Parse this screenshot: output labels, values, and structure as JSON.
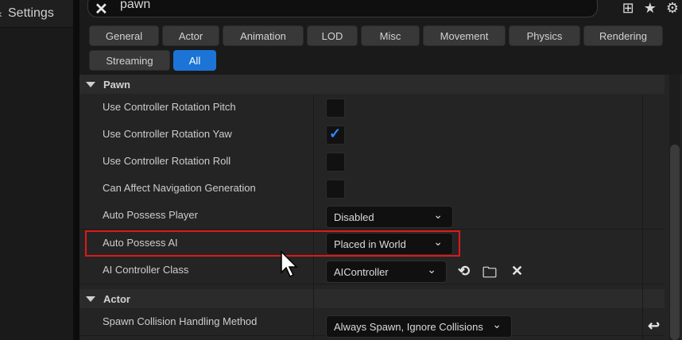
{
  "left": {
    "title": "Settings"
  },
  "search": {
    "value": "pawn"
  },
  "filters": [
    "General",
    "Actor",
    "Animation",
    "LOD",
    "Misc",
    "Movement",
    "Physics",
    "Rendering",
    "Streaming",
    "All"
  ],
  "categories": {
    "pawn": "Pawn",
    "actor": "Actor"
  },
  "rows": {
    "pitch": "Use Controller Rotation Pitch",
    "yaw": "Use Controller Rotation Yaw",
    "roll": "Use Controller Rotation Roll",
    "nav": "Can Affect Navigation Generation",
    "player": "Auto Possess Player",
    "ai": "Auto Possess AI",
    "aiclass": "AI Controller Class",
    "spawn": "Spawn Collision Handling Method"
  },
  "values": {
    "pitch": false,
    "yaw": true,
    "roll": false,
    "nav": false,
    "player": "Disabled",
    "ai": "Placed in World",
    "aiclass": "AIController",
    "spawn": "Always Spawn, Ignore Collisions"
  },
  "icons": {
    "clear": "close-icon",
    "grid": "grid-icon",
    "favorite": "star-icon",
    "settings": "gear-icon",
    "use_selected": "arrow-left-icon",
    "browse": "browse-folder-icon",
    "clear_value": "close-icon",
    "reset": "reset-arrow-icon"
  },
  "colors": {
    "accent": "#1b74d6",
    "highlight": "#e01818"
  }
}
